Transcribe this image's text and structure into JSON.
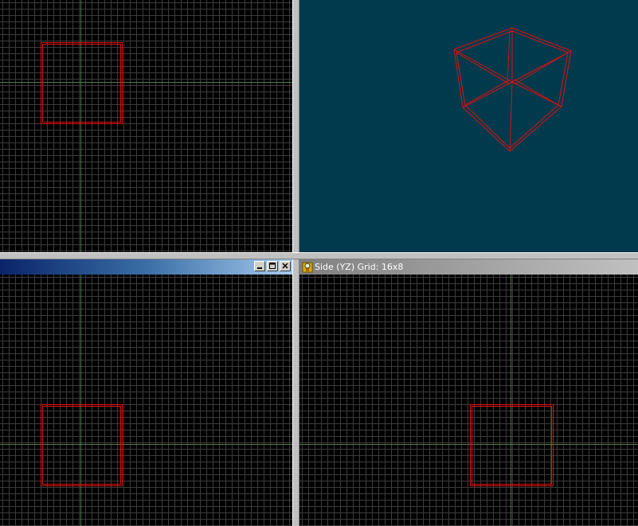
{
  "viewports": {
    "top_left": {
      "title": ""
    },
    "top_right": {
      "title": ""
    },
    "bottom_left": {
      "title": ""
    },
    "bottom_right": {
      "title": "Side (YZ) Grid: 16x8"
    }
  },
  "colors": {
    "grid_background": "#000000",
    "grid_line": "#3c3c3c",
    "axis_line": "#4a7a4a",
    "brush_wire": "#e01010",
    "view3d_background": "#003a4c",
    "splitter": "#c0c0c0"
  },
  "icons": {
    "minimize": "minimize-icon",
    "maximize": "maximize-icon",
    "close": "close-icon",
    "app": "app-icon"
  }
}
